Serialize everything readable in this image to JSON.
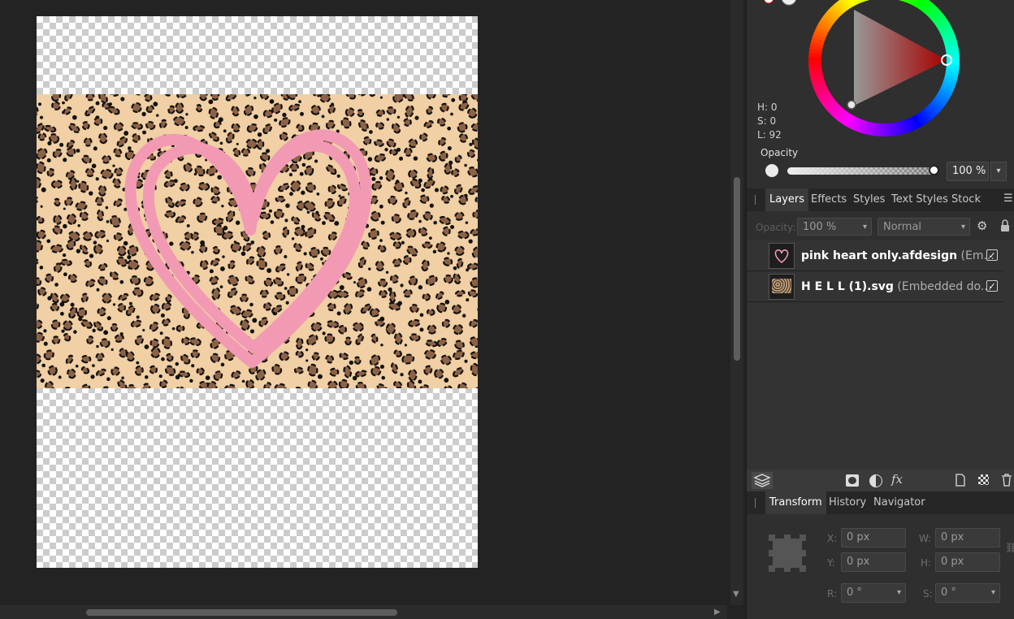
{
  "color": {
    "h_label": "H: 0",
    "s_label": "S: 0",
    "l_label": "L: 92",
    "opacity_label": "Opacity",
    "opacity_value": "100 %"
  },
  "layers_panel": {
    "tabs": [
      "Layers",
      "Effects",
      "Styles",
      "Text Styles",
      "Stock"
    ],
    "opacity_label": "Opacity:",
    "opacity_value": "100 %",
    "blend_mode": "Normal",
    "layers": [
      {
        "name": "pink heart only.afdesign",
        "suffix": " (Em...",
        "visible": true
      },
      {
        "name": "H E L L (1).svg",
        "suffix": " (Embedded do...",
        "visible": true
      }
    ]
  },
  "transform_panel": {
    "tabs": [
      "Transform",
      "History",
      "Navigator"
    ],
    "x_label": "X:",
    "x_value": "0 px",
    "y_label": "Y:",
    "y_value": "0 px",
    "w_label": "W:",
    "w_value": "0 px",
    "h_label": "H:",
    "h_value": "0 px",
    "r_label": "R:",
    "r_value": "0 °",
    "s_label": "S:",
    "s_value": "0 °"
  },
  "colors": {
    "heart": "#f29ab3",
    "leopard_base": "#f0d0a4",
    "spot_dark": "#111111",
    "spot_brown": "#8c6246"
  },
  "icons": [
    "layers-stack-icon",
    "mask-icon",
    "adjustment-icon",
    "fx-icon",
    "new-layer-icon",
    "pixel-layer-icon",
    "trash-icon",
    "gear-icon",
    "lock-icon",
    "menu-icon",
    "link-icon"
  ]
}
